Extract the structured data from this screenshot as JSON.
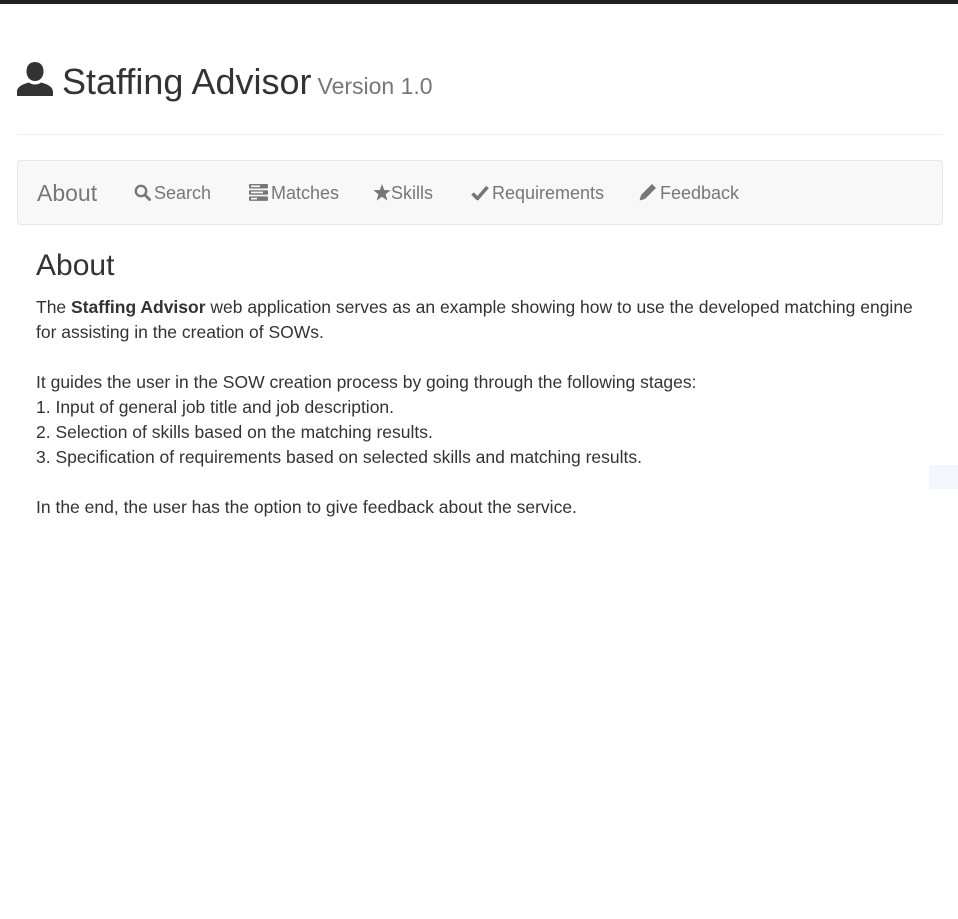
{
  "header": {
    "icon": "user-icon",
    "title": "Staffing Advisor",
    "version": "Version 1.0"
  },
  "nav": {
    "brand": "About",
    "items": [
      {
        "label": "Search",
        "icon": "search-icon"
      },
      {
        "label": "Matches",
        "icon": "tasks-icon"
      },
      {
        "label": "Skills",
        "icon": "star-icon"
      },
      {
        "label": "Requirements",
        "icon": "check-icon"
      },
      {
        "label": "Feedback",
        "icon": "pencil-icon"
      }
    ]
  },
  "about": {
    "heading": "About",
    "intro_prefix": "The ",
    "intro_bold": "Staffing Advisor",
    "intro_rest": " web application serves as an example showing how to use the developed matching engine for assisting in the creation of SOWs.",
    "stages_intro": "It guides the user in the SOW creation process by going through the following stages:",
    "stages": [
      "1. Input of general job title and job description.",
      "2. Selection of skills based on the matching results.",
      "3. Specification of requirements based on selected skills and matching results."
    ],
    "closing": "In the end, the user has the option to give feedback about the service."
  },
  "colors": {
    "nav_bg": "#f8f8f8",
    "nav_text": "#777777",
    "text": "#333333"
  }
}
